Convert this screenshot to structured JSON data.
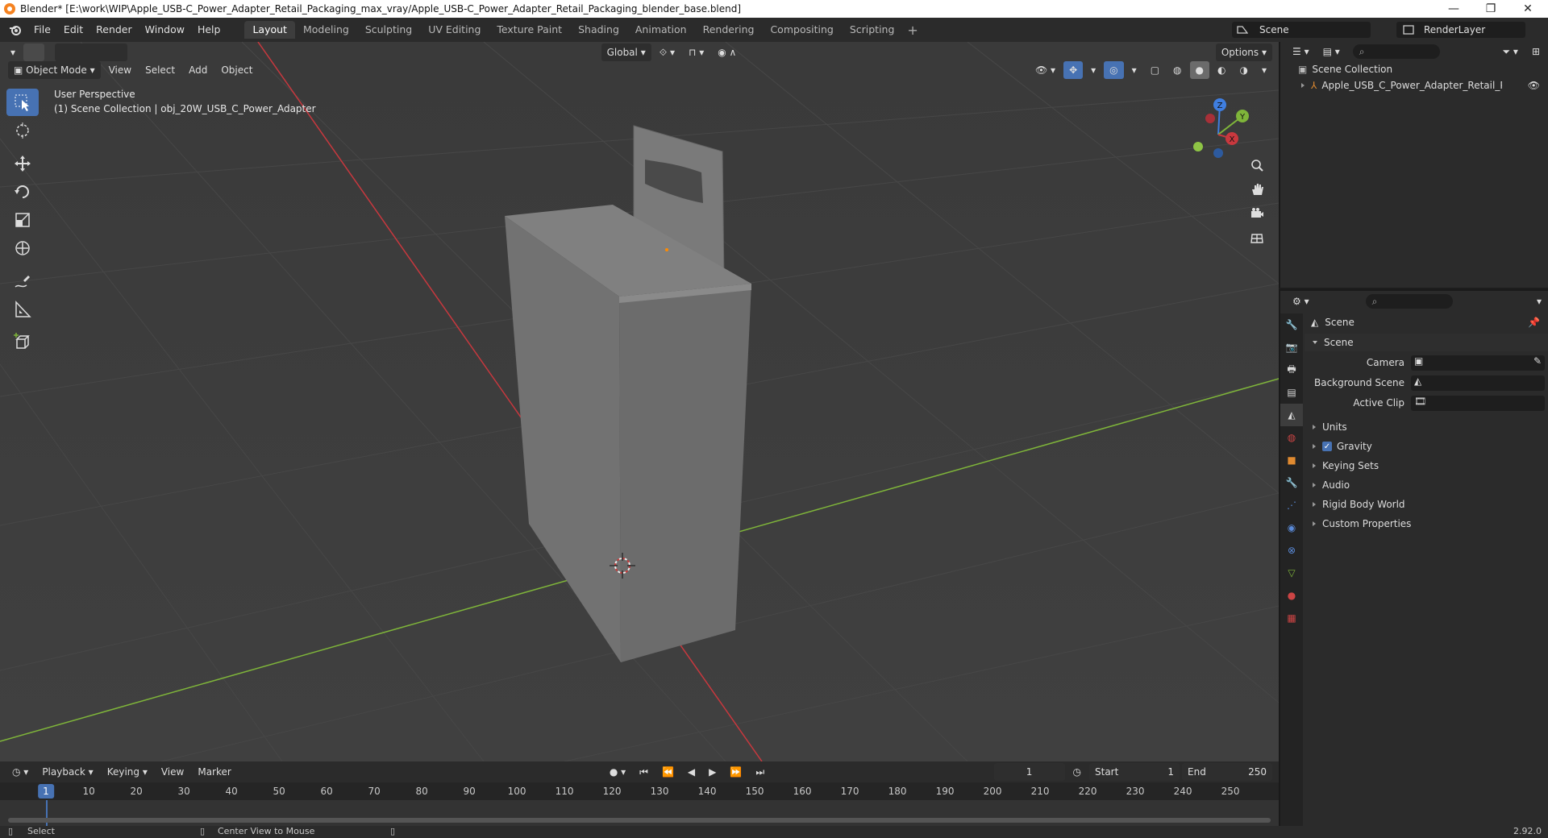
{
  "window": {
    "title": "Blender* [E:\\work\\WIP\\Apple_USB-C_Power_Adapter_Retail_Packaging_max_vray/Apple_USB-C_Power_Adapter_Retail_Packaging_blender_base.blend]",
    "minimize": "—",
    "maximize": "❐",
    "close": "✕"
  },
  "menu": [
    "File",
    "Edit",
    "Render",
    "Window",
    "Help"
  ],
  "workspaces": [
    {
      "label": "Layout",
      "active": true
    },
    {
      "label": "Modeling",
      "active": false
    },
    {
      "label": "Sculpting",
      "active": false
    },
    {
      "label": "UV Editing",
      "active": false
    },
    {
      "label": "Texture Paint",
      "active": false
    },
    {
      "label": "Shading",
      "active": false
    },
    {
      "label": "Animation",
      "active": false
    },
    {
      "label": "Rendering",
      "active": false
    },
    {
      "label": "Compositing",
      "active": false
    },
    {
      "label": "Scripting",
      "active": false
    }
  ],
  "scene_selector": "Scene",
  "view_layer": "RenderLayer",
  "viewport": {
    "mode": "Object Mode",
    "menus": [
      "View",
      "Select",
      "Add",
      "Object"
    ],
    "transform_orientation": "Global",
    "options_label": "Options",
    "overlay_line1": "User Perspective",
    "overlay_line2": "(1) Scene Collection | obj_20W_USB_C_Power_Adapter",
    "gizmo": {
      "z": "Z",
      "y": "Y",
      "x": "X"
    },
    "tools": [
      "select-box-icon",
      "cursor-icon",
      "move-icon",
      "rotate-icon",
      "scale-icon",
      "transform-icon",
      "annotate-icon",
      "measure-icon",
      "add-cube-icon"
    ]
  },
  "timeline": {
    "menus": [
      "Playback",
      "Keying",
      "View",
      "Marker"
    ],
    "current_frame": "1",
    "start_label": "Start",
    "start": "1",
    "end_label": "End",
    "end": "250",
    "ruler_ticks": [
      "10",
      "20",
      "30",
      "40",
      "50",
      "60",
      "70",
      "80",
      "90",
      "100",
      "110",
      "120",
      "130",
      "140",
      "150",
      "160",
      "170",
      "180",
      "190",
      "200",
      "210",
      "220",
      "230",
      "240",
      "250"
    ],
    "ruler_current": "1"
  },
  "statusbar": {
    "left": "Select",
    "middle": "Center View to Mouse",
    "version": "2.92.0"
  },
  "outliner": {
    "root": "Scene Collection",
    "items": [
      {
        "label": "Apple_USB_C_Power_Adapter_Retail_Packag"
      }
    ]
  },
  "properties": {
    "context": "Scene",
    "panel_title": "Scene",
    "fields": [
      {
        "label": "Camera"
      },
      {
        "label": "Background Scene"
      },
      {
        "label": "Active Clip"
      }
    ],
    "subpanels": [
      {
        "label": "Units",
        "checkbox": false
      },
      {
        "label": "Gravity",
        "checkbox": true
      },
      {
        "label": "Keying Sets",
        "checkbox": false
      },
      {
        "label": "Audio",
        "checkbox": false
      },
      {
        "label": "Rigid Body World",
        "checkbox": false
      },
      {
        "label": "Custom Properties",
        "checkbox": false
      }
    ]
  },
  "colors": {
    "accent": "#4772b3",
    "axis_x": "#c8383e",
    "axis_y": "#7fb53a",
    "axis_z": "#3f7ee0"
  }
}
